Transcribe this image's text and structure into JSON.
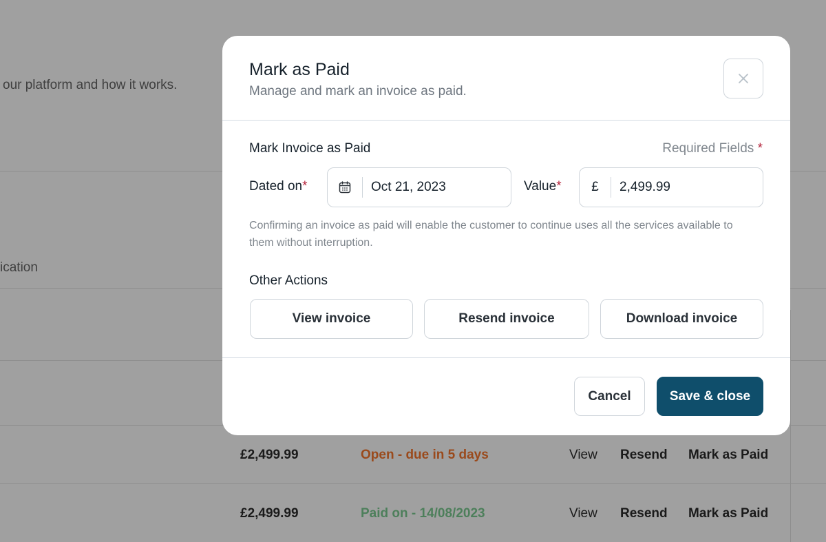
{
  "background": {
    "intro_fragment": "our platform and how it works.",
    "column_fragment": "ication",
    "rows": [
      {
        "amount": "£2,499.99",
        "status": "Open - due in 5 days",
        "view": "View",
        "resend": "Resend",
        "mark_paid": "Mark as Paid"
      },
      {
        "amount": "£2,499.99",
        "status": "Paid on - 14/08/2023",
        "view": "View",
        "resend": "Resend",
        "mark_paid": "Mark as Paid"
      }
    ],
    "status_colors": {
      "open": "#9a4a1c",
      "paid": "#4d7f5b"
    }
  },
  "modal": {
    "title": "Mark as Paid",
    "subtitle": "Manage and mark an invoice as paid.",
    "close_icon": "close-icon",
    "section_title": "Mark Invoice as Paid",
    "required_note": "Required Fields",
    "required_star": "*",
    "dated_on": {
      "label": "Dated on",
      "value": "Oct 21, 2023",
      "icon": "calendar-icon"
    },
    "value_field": {
      "label": "Value",
      "currency": "£",
      "value": "2,499.99"
    },
    "help_text": "Confirming an invoice as paid will enable the customer to continue uses all the services available to them without interruption.",
    "other_actions": {
      "title": "Other Actions",
      "view": "View invoice",
      "resend": "Resend invoice",
      "download": "Download invoice"
    },
    "footer": {
      "cancel": "Cancel",
      "save": "Save & close"
    },
    "colors": {
      "primary": "#0f4e6b",
      "required": "#b4223a"
    }
  }
}
